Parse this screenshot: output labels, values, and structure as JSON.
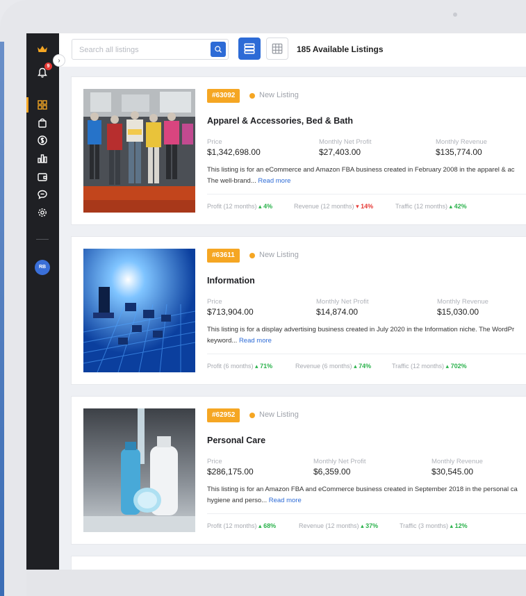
{
  "app": {
    "notification_count": "9",
    "user_initials": "RB",
    "accent_color": "#2d6bd6",
    "badge_color": "#f5a623"
  },
  "sidebar": {
    "items": [
      {
        "icon": "dashboard-grid-icon"
      },
      {
        "icon": "shopping-bag-icon"
      },
      {
        "icon": "dollar-circle-icon"
      },
      {
        "icon": "bar-chart-icon"
      },
      {
        "icon": "wallet-icon"
      },
      {
        "icon": "chat-icon"
      },
      {
        "icon": "gear-icon"
      }
    ]
  },
  "search": {
    "placeholder": "Search all listings"
  },
  "header": {
    "listing_count": "185 Available Listings"
  },
  "listings": [
    {
      "id": "#63092",
      "status": "New Listing",
      "title": "Apparel & Accessories, Bed & Bath",
      "price_label": "Price",
      "price": "$1,342,698.00",
      "profit_label": "Monthly Net Profit",
      "profit": "$27,403.00",
      "revenue_label": "Monthly Revenue",
      "revenue": "$135,774.00",
      "desc_line1": "This listing is for an eCommerce and Amazon FBA business created in February 2008 in the apparel & ac",
      "desc_line2": "The well-brand...",
      "read_more": "Read more",
      "stats": [
        {
          "label": "Profit (12 months)",
          "value": "4%",
          "trend": "up"
        },
        {
          "label": "Revenue (12 months)",
          "value": "14%",
          "trend": "down"
        },
        {
          "label": "Traffic (12 months)",
          "value": "42%",
          "trend": "up"
        }
      ]
    },
    {
      "id": "#63611",
      "status": "New Listing",
      "title": "Information",
      "price_label": "Price",
      "price": "$713,904.00",
      "profit_label": "Monthly Net Profit",
      "profit": "$14,874.00",
      "revenue_label": "Monthly Revenue",
      "revenue": "$15,030.00",
      "desc_line1": "This listing is for a display advertising business created in July 2020 in the Information niche. The WordPr",
      "desc_line2": "keyword...",
      "read_more": "Read more",
      "stats": [
        {
          "label": "Profit (6 months)",
          "value": "71%",
          "trend": "up"
        },
        {
          "label": "Revenue (6 months)",
          "value": "74%",
          "trend": "up"
        },
        {
          "label": "Traffic (12 months)",
          "value": "702%",
          "trend": "up"
        }
      ]
    },
    {
      "id": "#62952",
      "status": "New Listing",
      "title": "Personal Care",
      "price_label": "Price",
      "price": "$286,175.00",
      "profit_label": "Monthly Net Profit",
      "profit": "$6,359.00",
      "revenue_label": "Monthly Revenue",
      "revenue": "$30,545.00",
      "desc_line1": "This listing is for an Amazon FBA and eCommerce business created in September 2018 in the personal ca",
      "desc_line2": "hygiene and perso...",
      "read_more": "Read more",
      "stats": [
        {
          "label": "Profit (12 months)",
          "value": "68%",
          "trend": "up"
        },
        {
          "label": "Revenue (12 months)",
          "value": "37%",
          "trend": "up"
        },
        {
          "label": "Traffic (3 months)",
          "value": "12%",
          "trend": "up"
        }
      ]
    }
  ]
}
